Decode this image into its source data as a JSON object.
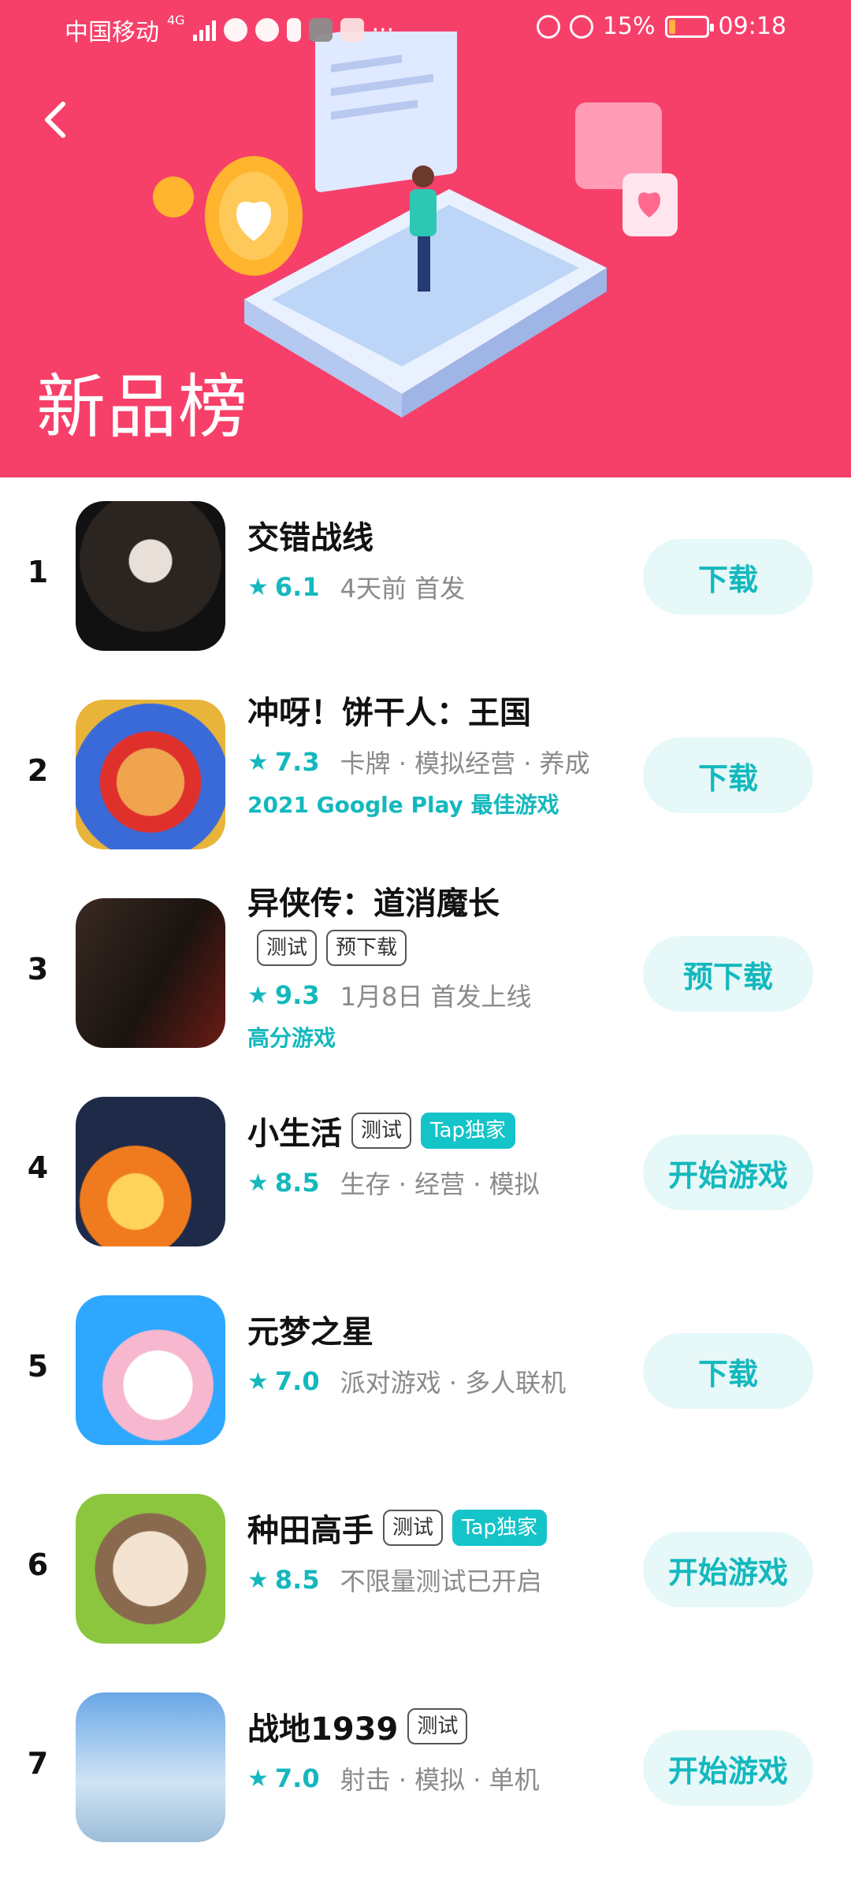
{
  "status_bar": {
    "carrier": "中国移动",
    "network": "4G",
    "battery_percent": "15%",
    "time": "09:18",
    "more": "···"
  },
  "header": {
    "title": "新品榜",
    "back_icon": "chevron-left-icon",
    "background_color": "#f6406a"
  },
  "games": [
    {
      "rank": "1",
      "name": "交错战线",
      "tags": [],
      "rating": "6.1",
      "meta": "4天前 首发",
      "badge": "",
      "action": "下载"
    },
    {
      "rank": "2",
      "name": "冲呀！饼干人：王国",
      "tags": [],
      "rating": "7.3",
      "meta": "卡牌 · 模拟经营 · 养成",
      "badge": "2021 Google Play 最佳游戏",
      "action": "下载"
    },
    {
      "rank": "3",
      "name": "异侠传：道消魔长",
      "tags": [
        "测试",
        "预下载"
      ],
      "rating": "9.3",
      "meta": "1月8日 首发上线",
      "badge": "高分游戏",
      "action": "预下载"
    },
    {
      "rank": "4",
      "name": "小生活",
      "tags": [
        "测试",
        "Tap独家"
      ],
      "rating": "8.5",
      "meta": "生存 · 经营 · 模拟",
      "badge": "",
      "action": "开始游戏"
    },
    {
      "rank": "5",
      "name": "元梦之星",
      "tags": [],
      "rating": "7.0",
      "meta": "派对游戏 · 多人联机",
      "badge": "",
      "action": "下载"
    },
    {
      "rank": "6",
      "name": "种田高手",
      "tags": [
        "测试",
        "Tap独家"
      ],
      "rating": "8.5",
      "meta": "不限量测试已开启",
      "badge": "",
      "action": "开始游戏"
    },
    {
      "rank": "7",
      "name": "战地1939",
      "tags": [
        "测试"
      ],
      "rating": "7.0",
      "meta": "射击 · 模拟 · 单机",
      "badge": "",
      "action": "开始游戏"
    }
  ],
  "colors": {
    "accent": "#14b8bd",
    "button_bg": "#e6f8f8",
    "tap_tag": "#14c4c9"
  }
}
